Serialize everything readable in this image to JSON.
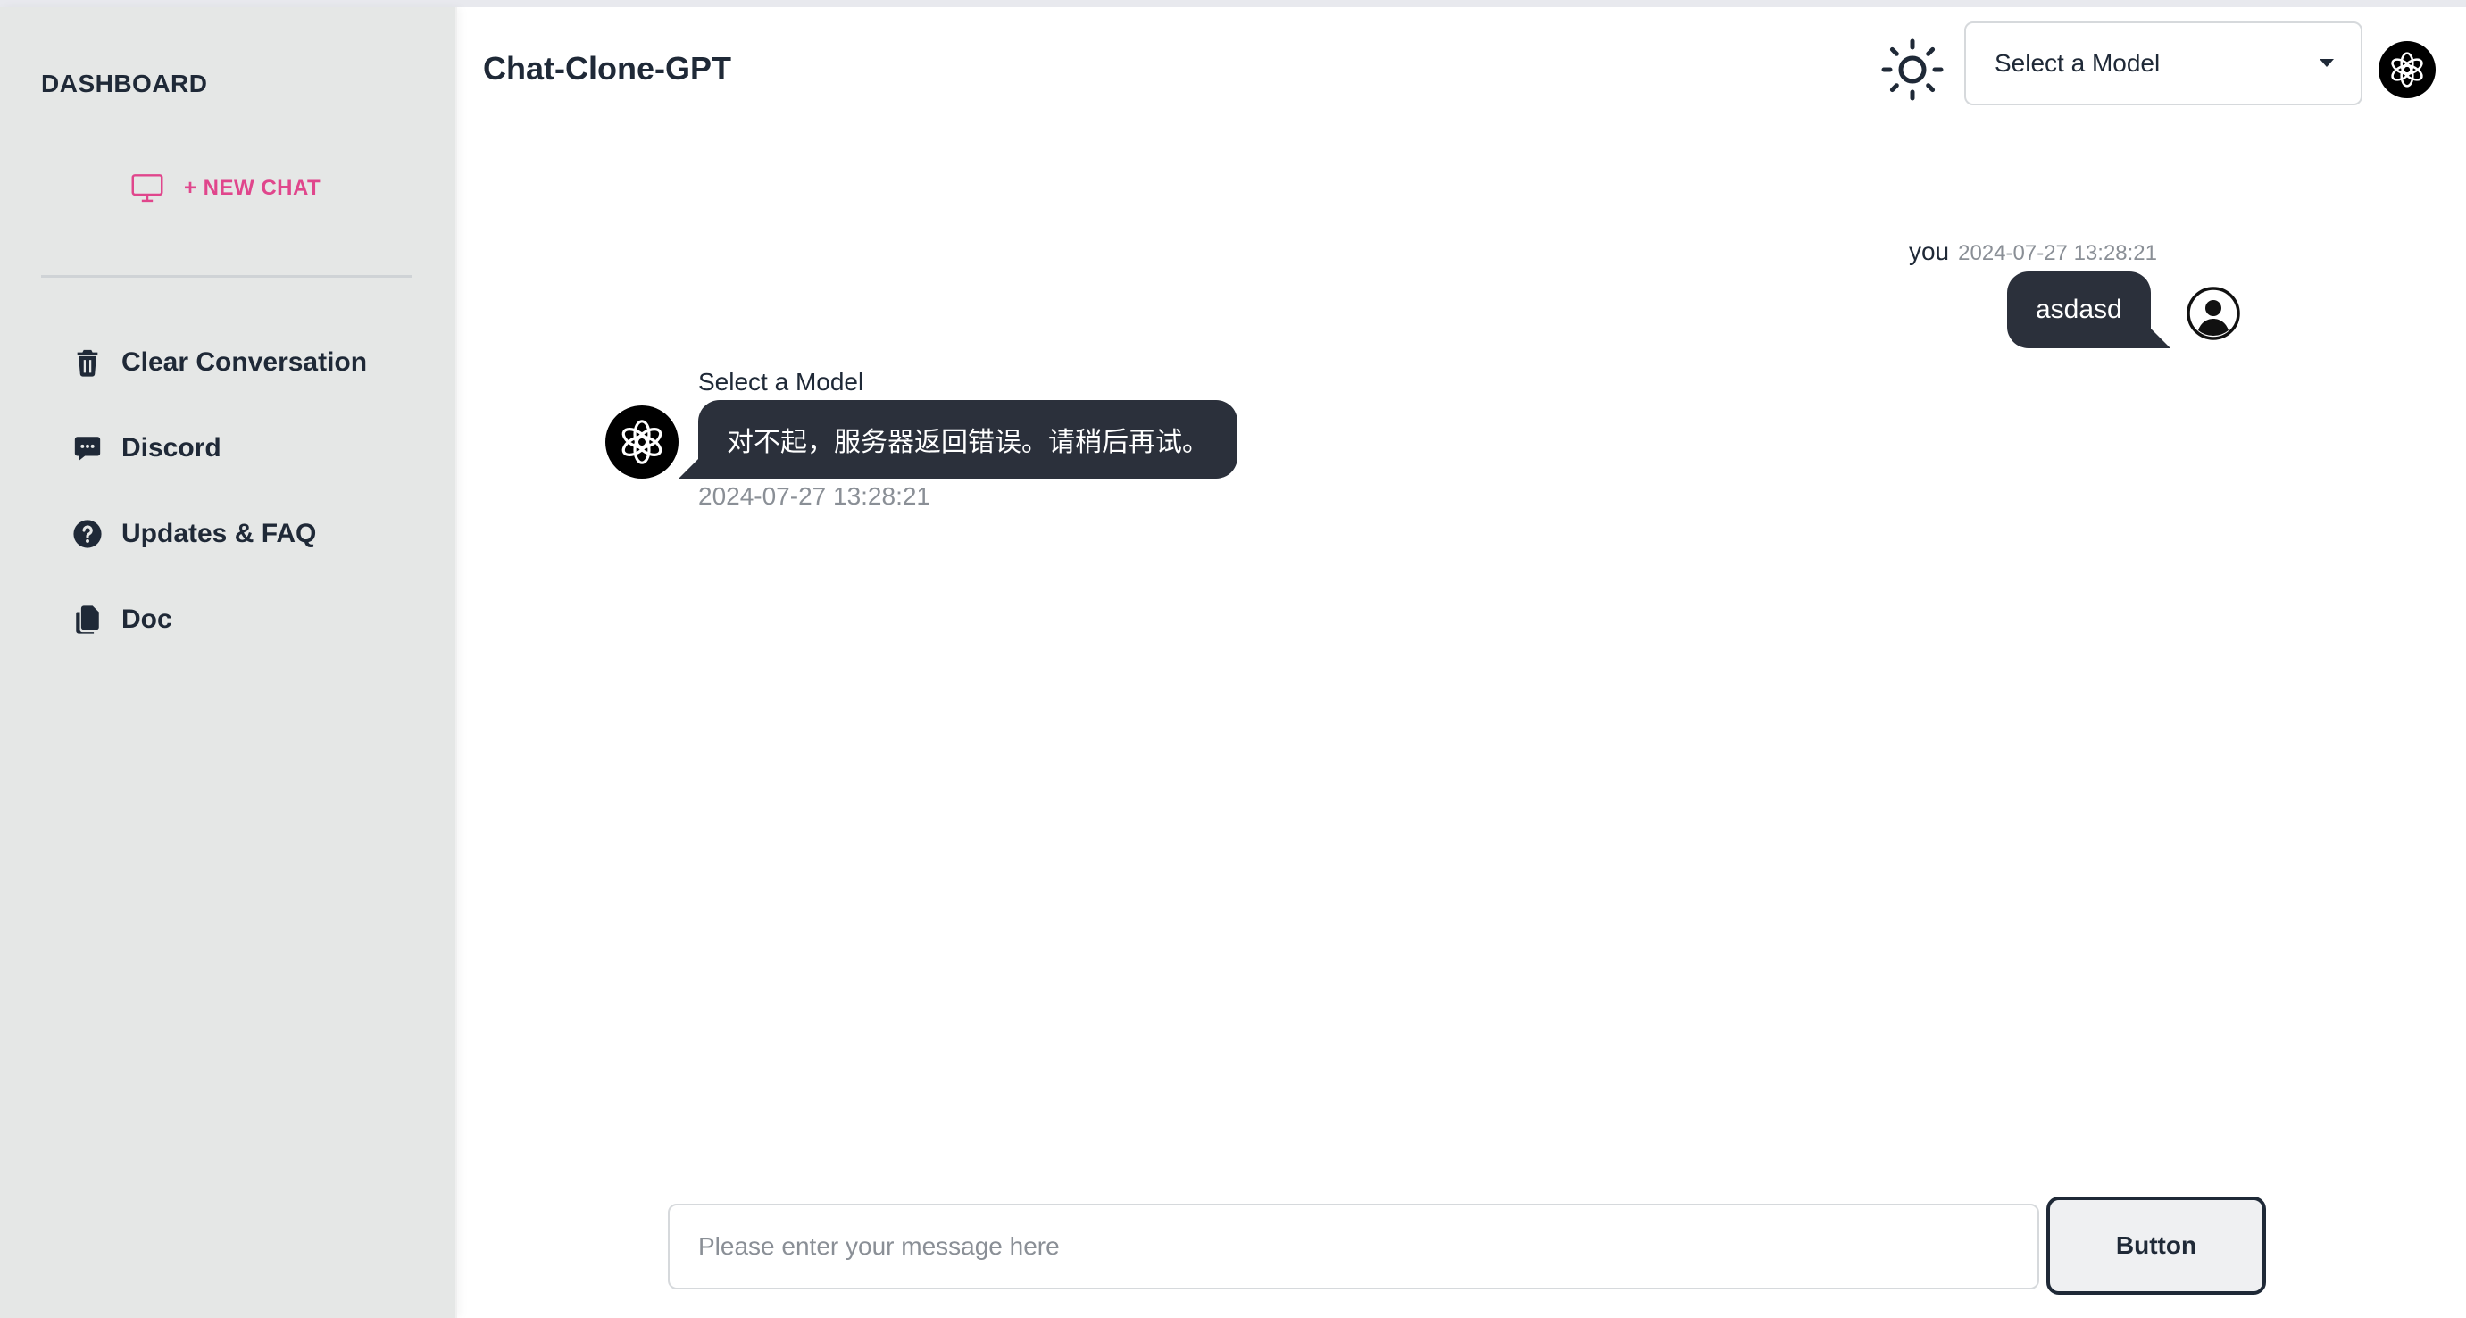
{
  "sidebar": {
    "title": "DASHBOARD",
    "new_chat": {
      "label": "+ NEW CHAT",
      "icon": "monitor-icon",
      "color": "#e0468c"
    },
    "items": [
      {
        "label": "Clear Conversation",
        "icon": "trash-icon"
      },
      {
        "label": "Discord",
        "icon": "chat-bubble-icon"
      },
      {
        "label": "Updates & FAQ",
        "icon": "question-circle-icon"
      },
      {
        "label": "Doc",
        "icon": "documents-icon"
      }
    ]
  },
  "header": {
    "title": "Chat-Clone-GPT",
    "theme_icon": "sun-icon",
    "model_select": {
      "value": "Select a Model"
    },
    "avatar_icon": "openai-logo-icon"
  },
  "messages": [
    {
      "role": "user",
      "sender": "you",
      "timestamp": "2024-07-27 13:28:21",
      "text": "asdasd",
      "avatar_icon": "user-circle-icon"
    },
    {
      "role": "assistant",
      "sender": "Select a Model",
      "timestamp": "2024-07-27 13:28:21",
      "text": "对不起，服务器返回错误。请稍后再试。",
      "avatar_icon": "openai-logo-icon"
    }
  ],
  "composer": {
    "placeholder": "Please enter your message here",
    "value": "",
    "button_label": "Button"
  },
  "colors": {
    "sidebar_bg": "#e5e7e6",
    "bubble_bg": "#2b303b",
    "accent": "#e0468c"
  }
}
